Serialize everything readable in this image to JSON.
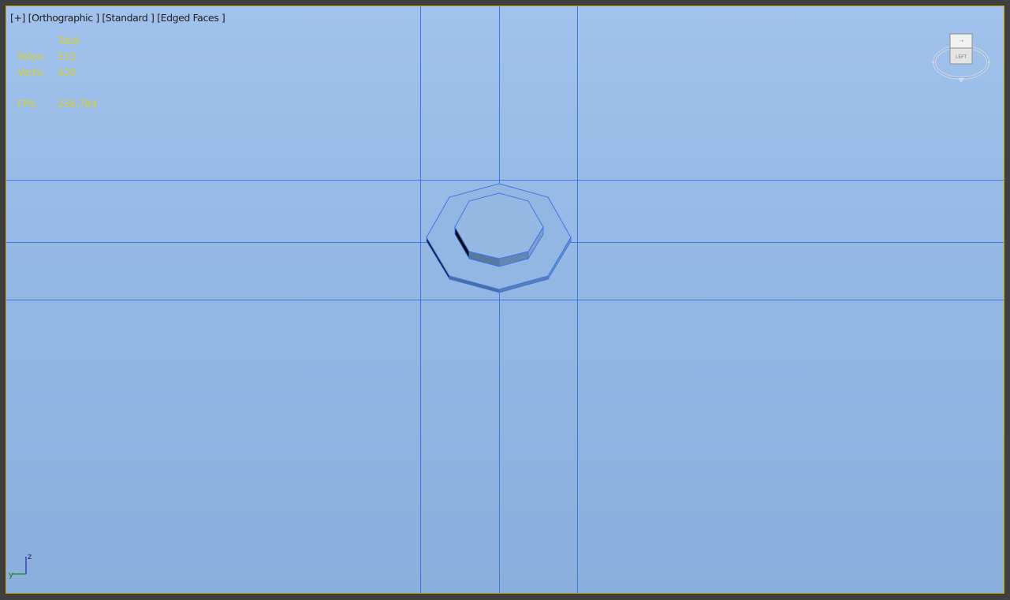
{
  "viewport": {
    "labels": {
      "plus": "[+]",
      "view": "[Orthographic ]",
      "shading": "[Standard ]",
      "edges": "[Edged Faces ]"
    },
    "stats": {
      "header": "Total",
      "polys_label": "Polys:",
      "polys_value": "513",
      "verts_label": "Verts:",
      "verts_value": "520",
      "fps_label": "FPS:",
      "fps_value": "256,784"
    },
    "viewcube": {
      "face_label": "LEFT"
    },
    "axis_gizmo": {
      "vertical_label": "z",
      "horizontal_label": "y"
    }
  },
  "colors": {
    "wire": "#3f76e8",
    "stats_text": "#d8d02c",
    "viewport_top": "#a0c2ec",
    "viewport_bottom": "#8aafdc"
  }
}
